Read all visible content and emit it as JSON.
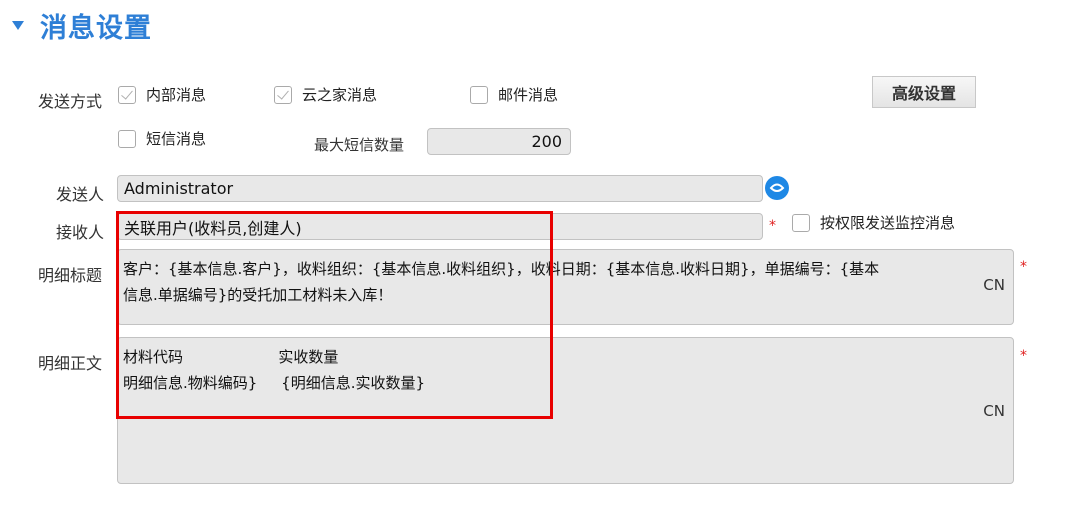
{
  "section": {
    "title": "消息设置"
  },
  "send_method": {
    "label": "发送方式",
    "options": [
      {
        "label": "内部消息",
        "checked": true
      },
      {
        "label": "云之家消息",
        "checked": true
      },
      {
        "label": "邮件消息",
        "checked": false
      },
      {
        "label": "短信消息",
        "checked": false
      }
    ],
    "advanced_button": "高级设置"
  },
  "sms": {
    "max_label": "最大短信数量",
    "max_value": "200"
  },
  "sender": {
    "label": "发送人",
    "value": "Administrator",
    "icon": "cloud-icon"
  },
  "receiver": {
    "label": "接收人",
    "value": "关联用户(收料员,创建人)",
    "required": "*",
    "permission_label": "按权限发送监控消息",
    "permission_checked": false
  },
  "detail_title": {
    "label": "明细标题",
    "line1": "客户：{基本信息.客户}，收料组织：{基本信息.收料组织}，收料日期：{基本信息.收料日期}，单据编号：{基本",
    "line2": "信息.单据编号}的受托加工材料未入库！",
    "lang": "CN",
    "required": "*"
  },
  "detail_body": {
    "label": "明细正文",
    "line1": "材料代码                    实收数量",
    "line2": "明细信息.物料编码}     {明细信息.实收数量}",
    "lang": "CN",
    "required": "*"
  },
  "colors": {
    "accent": "#2e7fd6",
    "highlight": "#e80000",
    "required": "#e02020"
  }
}
